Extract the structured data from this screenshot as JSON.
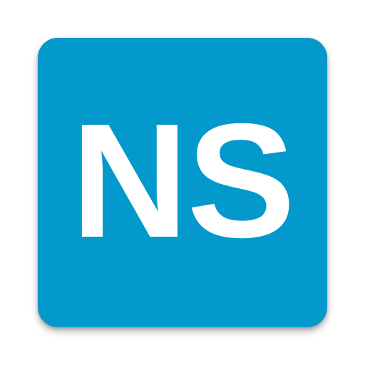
{
  "icon": {
    "name": "app-icon",
    "text": "NS",
    "background_color": "#0399CC",
    "text_color": "#FFFFFF"
  }
}
